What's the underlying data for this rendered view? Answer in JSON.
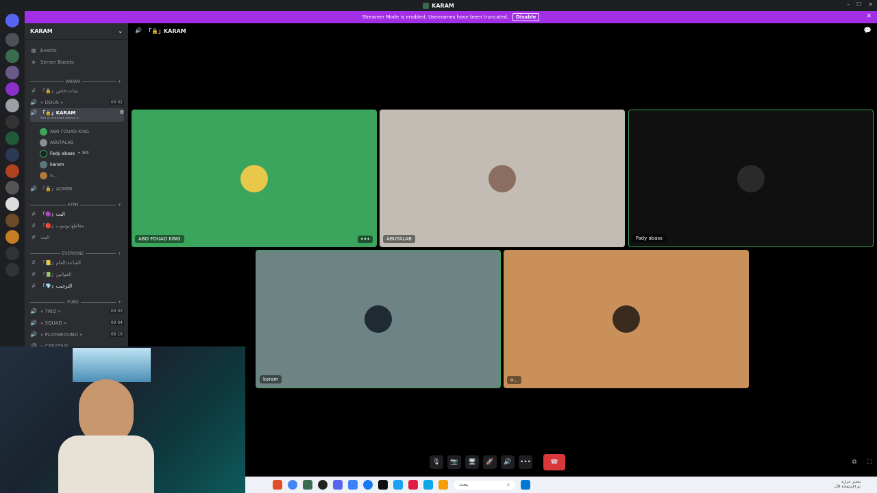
{
  "window": {
    "title": "KARAM",
    "min": "–",
    "max": "☐",
    "close": "✕"
  },
  "banner": {
    "text": "Streamer Mode is enabled. Usernames have been truncated.",
    "button": "Disable",
    "close": "✕"
  },
  "sidebar": {
    "server_name": "KARAM",
    "top_items": [
      {
        "label": "Events",
        "icon": "calendar-icon"
      },
      {
        "label": "Server Boosts",
        "icon": "boost-icon"
      }
    ],
    "categories": {
      "karam": "KARAM",
      "etpn": "ETPN",
      "everyone": "EVERYONE",
      "pubg": "PUBG"
    },
    "channels": {
      "c1": "「🔒」شات-خاص",
      "c2": "« DOUS »",
      "c2_count": "00 02",
      "c3": "「🔒」KARAM",
      "c3_status": "Set a channel status ✏",
      "c4": "「🔒」ADMIN",
      "c5": "「🟣」البث",
      "c6": "「🔴」مقاطع-يوتيوب",
      "c7": "البث",
      "c8": "「📒」القناعة-العام",
      "c9": "「📗」القوانين",
      "c10": "「💎」الترحيب",
      "c11": "« TRIO »",
      "c11_count": "00 03",
      "c12": "« SQUAD »",
      "c12_count": "00 04",
      "c13": "« PLAYGROUND »",
      "c13_count": "00 16",
      "c14": "« CREATIVE"
    },
    "voice_users": [
      {
        "name": "ABO FOUAD KING",
        "color": "#3ba55d"
      },
      {
        "name": "ABUTALAB",
        "color": "#8a8f94"
      },
      {
        "name": "Fady abass",
        "badge": "✦ 365",
        "color": "#1e1f22"
      },
      {
        "name": "karam",
        "color": "#5e7778"
      },
      {
        "name": "o...",
        "color": "#b07a3a"
      }
    ]
  },
  "call": {
    "channel_header": "「🔒」KARAM",
    "tiles": [
      {
        "name": "ABO FOUAD KING",
        "bg": "#3ba55d",
        "avatar": "#e7c84a"
      },
      {
        "name": "ABUTALAB",
        "bg": "#c2bcb4",
        "avatar": "#8a6f60"
      },
      {
        "name": "Fady abass",
        "bg": "#101010",
        "avatar": "#2a2a2a"
      },
      {
        "name": "karam",
        "bg": "#6e8384",
        "avatar": "#1f2a33"
      },
      {
        "name": "o...",
        "bg": "#c99159",
        "avatar": "#3a2a1e"
      }
    ],
    "more": "•••",
    "controls": {
      "mic": "🎙",
      "cam": "📷",
      "screen": "🖥",
      "activity": "🚀",
      "soundboard": "🔊",
      "more": "•••",
      "hangup": "☎"
    }
  },
  "taskbar": {
    "search_placeholder": "بحث",
    "tray_line1": "تحذير حرارة",
    "tray_line2": "تم الإستفادة الآن"
  }
}
